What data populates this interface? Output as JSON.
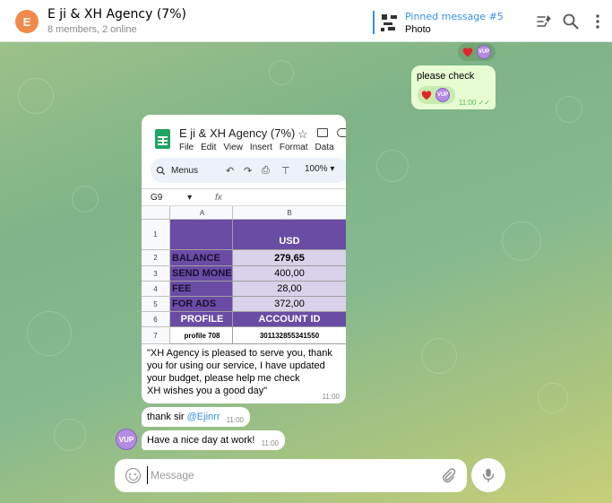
{
  "header": {
    "avatar_letter": "E",
    "title": "E ji & XH Agency (7%)",
    "subtitle": "8 members, 2 online",
    "pinned_title": "Pinned message #5",
    "pinned_value": "Photo"
  },
  "reactions_avatar_text": "VUP",
  "outgoing": {
    "text": "please check",
    "time": "11:00"
  },
  "sheet": {
    "title": "E ji & XH Agency (7%)",
    "menu": [
      "File",
      "Edit",
      "View",
      "Insert",
      "Format",
      "Data"
    ],
    "menus_label": "Menus",
    "zoom": "100%",
    "cell_ref": "G9",
    "fx": "fx",
    "col_a": "A",
    "col_b": "B",
    "rows": [
      {
        "num": "1",
        "a": "",
        "b": "USD"
      },
      {
        "num": "2",
        "a": "BALANCE",
        "b": "279,65"
      },
      {
        "num": "3",
        "a": "SEND MONEY",
        "b": "400,00"
      },
      {
        "num": "4",
        "a": "FEE",
        "b": "28,00"
      },
      {
        "num": "5",
        "a": "FOR ADS",
        "b": "372,00"
      },
      {
        "num": "6",
        "a": "PROFILE",
        "b": "ACCOUNT ID"
      },
      {
        "num": "7",
        "a": "profile 708",
        "b": "301132855341550"
      }
    ]
  },
  "photo_caption": "\"XH Agency is pleased to serve you, thank you for using our service, I have updated your budget, please help me check\nXH wishes you a good day\"",
  "photo_time": "11:00",
  "msg_thanks": {
    "text": "thank sir ",
    "mention": "@Ejinrr",
    "time": "11:00"
  },
  "msg_nice": {
    "text": "Have a nice day at work!",
    "time": "11:00"
  },
  "sender_avatar_text": "VUP",
  "composer": {
    "placeholder": "Message"
  },
  "colors": {
    "accent": "#3390ec",
    "sheet_purple": "#6a4ca5",
    "sheet_lavender": "#d9d2ea",
    "out_bubble": "#e7fcd3"
  }
}
